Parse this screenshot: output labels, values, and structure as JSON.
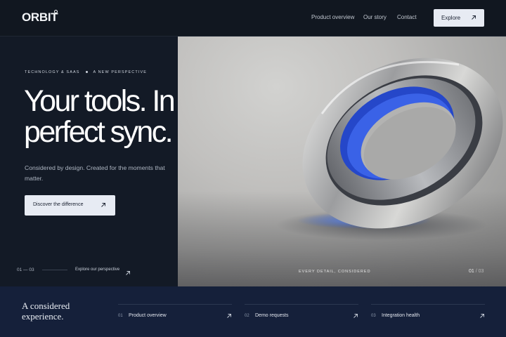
{
  "header": {
    "logo": "ORBIT",
    "nav": [
      "Product overview",
      "Our story",
      "Contact"
    ],
    "cta_label": "Explore"
  },
  "hero": {
    "eyebrow_left": "TECHNOLOGY & SAAS",
    "eyebrow_right": "A NEW PERSPECTIVE",
    "headline_line1": "Your tools. In",
    "headline_line2": "perfect sync.",
    "subcopy": "Considered by design. Created for the moments that matter.",
    "cta_label": "Discover the difference",
    "slide_counter": "01 — 03",
    "perspective_link": "Explore our perspective"
  },
  "image": {
    "caption": "EVERY DETAIL, CONSIDERED",
    "counter_current": "01",
    "counter_sep": " / ",
    "counter_total": "03"
  },
  "bottom": {
    "title": "A considered experience.",
    "features": [
      {
        "num": "01",
        "label": "Product overview"
      },
      {
        "num": "02",
        "label": "Demo requests"
      },
      {
        "num": "03",
        "label": "Integration health"
      }
    ]
  },
  "colors": {
    "background": "#111720",
    "bottom_strip": "#15203a",
    "button": "#e7ebf3",
    "accent_blue": "#2f5fe0"
  },
  "icons": {
    "arrow": "arrow-up-right-icon",
    "logo_mark": "registered-circle-icon"
  }
}
